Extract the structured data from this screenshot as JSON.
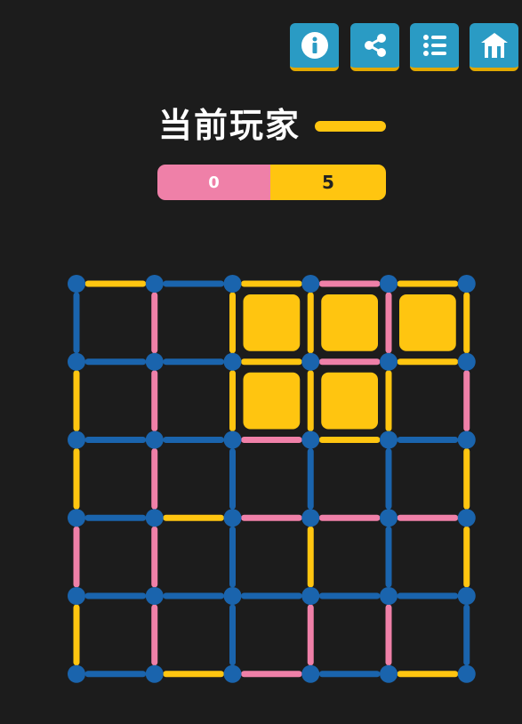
{
  "title": "当前玩家",
  "colors": {
    "background": "#1c1c1c",
    "blue": "#1a64ad",
    "pink": "#ef80a8",
    "yellow": "#ffc510",
    "toolbar": "#2a9bc4"
  },
  "toolbar": [
    {
      "name": "info-button",
      "icon": "info-icon"
    },
    {
      "name": "share-button",
      "icon": "share-icon"
    },
    {
      "name": "menu-button",
      "icon": "list-icon"
    },
    {
      "name": "home-button",
      "icon": "home-icon"
    }
  ],
  "current_player": "yellow",
  "score": {
    "pink": "0",
    "yellow": "5"
  },
  "board": {
    "rows": 5,
    "cols": 5,
    "horizontal": [
      [
        "yellow",
        "blue",
        "yellow",
        "pink",
        "yellow"
      ],
      [
        "blue",
        "blue",
        "yellow",
        "pink",
        "yellow"
      ],
      [
        "blue",
        "blue",
        "pink",
        "yellow",
        "blue"
      ],
      [
        "blue",
        "yellow",
        "pink",
        "pink",
        "pink"
      ],
      [
        "blue",
        "blue",
        "blue",
        "blue",
        "blue"
      ],
      [
        "blue",
        "yellow",
        "pink",
        "blue",
        "yellow"
      ]
    ],
    "vertical": [
      [
        "blue",
        "pink",
        "yellow",
        "yellow",
        "pink",
        "yellow"
      ],
      [
        "yellow",
        "pink",
        "yellow",
        "yellow",
        "yellow",
        "pink"
      ],
      [
        "yellow",
        "pink",
        "blue",
        "blue",
        "blue",
        "yellow"
      ],
      [
        "pink",
        "pink",
        "blue",
        "yellow",
        "blue",
        "yellow"
      ],
      [
        "yellow",
        "pink",
        "blue",
        "pink",
        "pink",
        "blue"
      ]
    ],
    "boxes": [
      [
        null,
        null,
        "yellow",
        "yellow",
        "yellow"
      ],
      [
        null,
        null,
        "yellow",
        "yellow",
        null
      ],
      [
        null,
        null,
        null,
        null,
        null
      ],
      [
        null,
        null,
        null,
        null,
        null
      ],
      [
        null,
        null,
        null,
        null,
        null
      ]
    ]
  }
}
